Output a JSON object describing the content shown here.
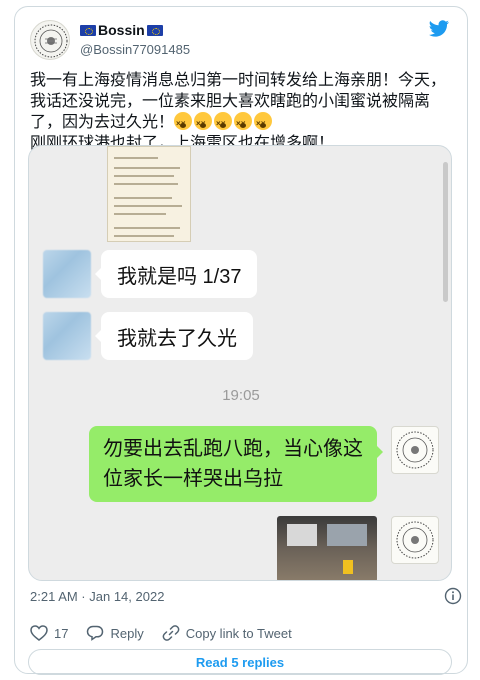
{
  "author": {
    "display_name": "Bossin",
    "handle": "@Bossin77091485"
  },
  "tweet": {
    "line1": "我一有上海疫情消息总归第一时间转发给上海亲朋！今天，我话还没说完，一位素来胆大喜欢瞎跑的小闺蜜说被隔离了，因为去过久光！",
    "line2": "刚刚环球港也封了，上海雷区也在增多啊！",
    "emoji_count": 5
  },
  "chat": {
    "msg1": "我就是吗 1/37",
    "msg2": "我就去了久光",
    "time": "19:05",
    "msg3": "勿要出去乱跑八跑，当心像这位家长一样哭出乌拉"
  },
  "meta": {
    "timestamp": "2:21 AM · Jan 14, 2022"
  },
  "actions": {
    "likes": "17",
    "reply": "Reply",
    "copy_link": "Copy link to Tweet",
    "read_replies": "Read 5 replies"
  },
  "colors": {
    "twitter_blue": "#1d9bf0",
    "wechat_green": "#95ec69",
    "muted_text": "#536471"
  }
}
